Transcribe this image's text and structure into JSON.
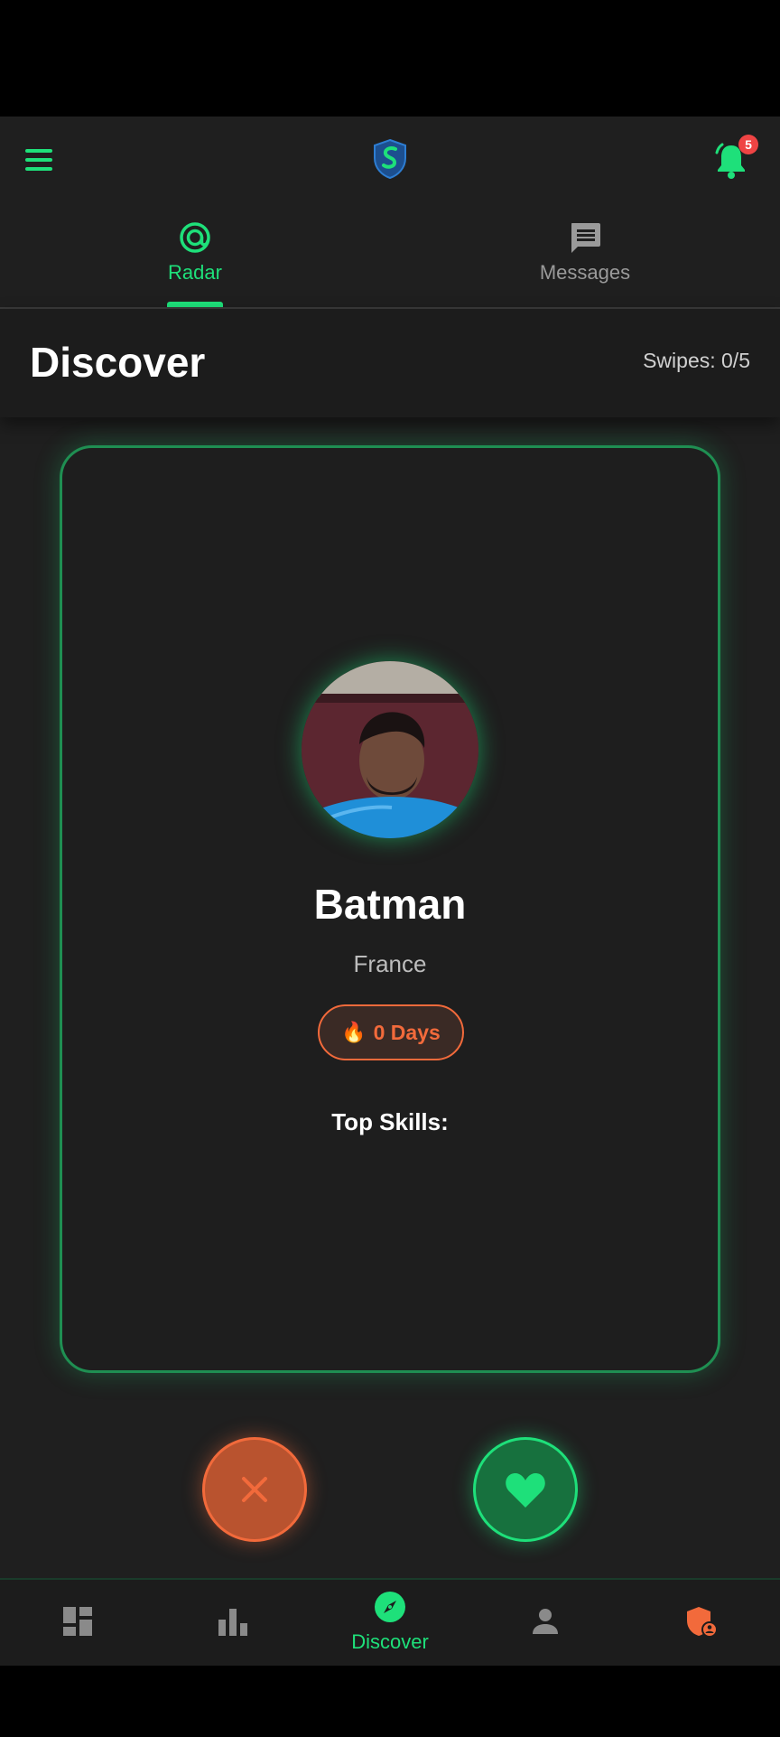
{
  "status_bar": {},
  "header": {
    "notifications_count": "5"
  },
  "tabs": [
    {
      "label": "Radar",
      "icon": "radar-icon",
      "active": true
    },
    {
      "label": "Messages",
      "icon": "chat-icon",
      "active": false
    }
  ],
  "discover": {
    "title": "Discover",
    "swipes": "Swipes: 0/5"
  },
  "profile": {
    "name": "Batman",
    "country": "France",
    "streak": "0 Days",
    "skills_heading": "Top Skills:"
  },
  "actions": {
    "reject_icon": "close-icon",
    "like_icon": "heart-icon"
  },
  "bottom_nav": {
    "items": [
      {
        "icon": "dashboard-icon",
        "label": ""
      },
      {
        "icon": "bar-chart-icon",
        "label": ""
      },
      {
        "icon": "compass-icon",
        "label": "Discover",
        "active": true
      },
      {
        "icon": "person-icon",
        "label": ""
      },
      {
        "icon": "shield-user-icon",
        "label": ""
      }
    ]
  },
  "colors": {
    "accent_green": "#1ee07a",
    "accent_orange": "#f26a3b",
    "background": "#1f1f1f"
  }
}
